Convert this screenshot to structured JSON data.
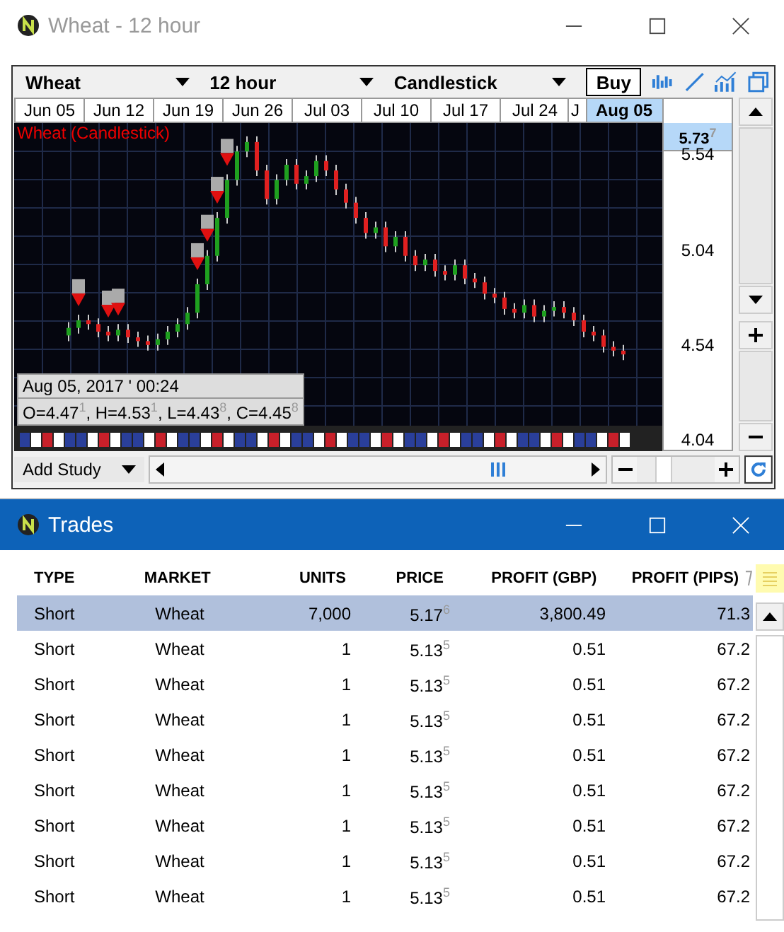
{
  "chart_window": {
    "title": "Wheat - 12 hour",
    "toolbar": {
      "market": "Wheat",
      "interval": "12 hour",
      "chart_type": "Candlestick",
      "buy": "Buy"
    },
    "chart_label": "Wheat (Candlestick)",
    "current_price": "5.73$^{7}$",
    "chart_data": {
      "type": "candlestick",
      "grid": true,
      "categories": [
        null,
        null,
        null,
        "Jun 05",
        null,
        null,
        null,
        null,
        null,
        null,
        "Jun 12",
        null,
        null,
        null,
        null,
        null,
        null,
        "Jun 19",
        null,
        null,
        null,
        null,
        null,
        null,
        "Jun 26",
        null,
        null,
        null,
        null,
        null,
        null,
        "Jul 03",
        null,
        null,
        null,
        null,
        null,
        null,
        "Jul 10",
        null,
        null,
        null,
        null,
        null,
        null,
        "Jul 17",
        null,
        null,
        null,
        null,
        null,
        null,
        "Jul 24",
        null,
        null,
        null,
        "J",
        null,
        null,
        null,
        null,
        "Aug 05"
      ],
      "ohlc": [
        null,
        null,
        null,
        null,
        null,
        [
          4.58,
          4.65,
          4.55,
          4.62
        ],
        [
          4.62,
          4.69,
          4.59,
          4.66
        ],
        [
          4.66,
          4.69,
          4.61,
          4.64
        ],
        [
          4.64,
          4.67,
          4.57,
          4.6
        ],
        [
          4.6,
          4.63,
          4.55,
          4.58
        ],
        [
          4.58,
          4.64,
          4.55,
          4.61
        ],
        [
          4.61,
          4.64,
          4.54,
          4.57
        ],
        [
          4.57,
          4.6,
          4.52,
          4.55
        ],
        [
          4.55,
          4.58,
          4.5,
          4.53
        ],
        [
          4.53,
          4.59,
          4.5,
          4.56
        ],
        [
          4.56,
          4.63,
          4.53,
          4.6
        ],
        [
          4.6,
          4.67,
          4.57,
          4.64
        ],
        [
          4.64,
          4.73,
          4.61,
          4.7
        ],
        [
          4.7,
          4.88,
          4.67,
          4.85
        ],
        [
          4.85,
          5.03,
          4.82,
          5.0
        ],
        [
          5.0,
          5.23,
          4.97,
          5.2
        ],
        [
          5.2,
          5.43,
          5.17,
          5.4
        ],
        [
          5.4,
          5.58,
          5.37,
          5.55
        ],
        [
          5.55,
          5.63,
          5.52,
          5.6
        ],
        [
          5.6,
          5.63,
          5.42,
          5.45
        ],
        [
          5.45,
          5.48,
          5.27,
          5.3
        ],
        [
          5.3,
          5.43,
          5.27,
          5.4
        ],
        [
          5.4,
          5.51,
          5.37,
          5.48
        ],
        [
          5.48,
          5.51,
          5.35,
          5.38
        ],
        [
          5.38,
          5.45,
          5.35,
          5.42
        ],
        [
          5.42,
          5.53,
          5.39,
          5.5
        ],
        [
          5.5,
          5.53,
          5.42,
          5.45
        ],
        [
          5.45,
          5.48,
          5.32,
          5.35
        ],
        [
          5.35,
          5.38,
          5.25,
          5.28
        ],
        [
          5.28,
          5.31,
          5.17,
          5.2
        ],
        [
          5.2,
          5.23,
          5.09,
          5.12
        ],
        [
          5.12,
          5.18,
          5.09,
          5.15
        ],
        [
          5.15,
          5.18,
          5.02,
          5.05
        ],
        [
          5.05,
          5.13,
          5.02,
          5.1
        ],
        [
          5.1,
          5.13,
          4.97,
          5.0
        ],
        [
          5.0,
          5.03,
          4.92,
          4.95
        ],
        [
          4.95,
          5.01,
          4.92,
          4.98
        ],
        [
          4.98,
          5.01,
          4.89,
          4.92
        ],
        [
          4.92,
          4.95,
          4.87,
          4.9
        ],
        [
          4.9,
          4.98,
          4.87,
          4.95
        ],
        [
          4.95,
          4.98,
          4.85,
          4.88
        ],
        [
          4.88,
          4.91,
          4.83,
          4.86
        ],
        [
          4.86,
          4.89,
          4.77,
          4.8
        ],
        [
          4.8,
          4.83,
          4.75,
          4.78
        ],
        [
          4.78,
          4.81,
          4.69,
          4.72
        ],
        [
          4.72,
          4.75,
          4.67,
          4.7
        ],
        [
          4.7,
          4.77,
          4.67,
          4.74
        ],
        [
          4.74,
          4.77,
          4.65,
          4.68
        ],
        [
          4.68,
          4.74,
          4.65,
          4.71
        ],
        [
          4.71,
          4.76,
          4.68,
          4.73
        ],
        [
          4.73,
          4.76,
          4.67,
          4.7
        ],
        [
          4.7,
          4.73,
          4.63,
          4.66
        ],
        [
          4.66,
          4.69,
          4.57,
          4.6
        ],
        [
          4.6,
          4.63,
          4.55,
          4.58
        ],
        [
          4.58,
          4.61,
          4.49,
          4.52
        ],
        [
          4.52,
          4.55,
          4.47,
          4.5
        ],
        [
          4.5,
          4.53,
          4.45,
          4.48
        ]
      ],
      "ylim": [
        3.97,
        5.7
      ],
      "yticks": [
        {
          "value": 5.54,
          "label": "5.54"
        },
        {
          "value": 5.04,
          "label": "5.04"
        },
        {
          "value": 4.54,
          "label": "4.54"
        },
        {
          "value": 4.04,
          "label": "4.04"
        }
      ]
    },
    "tooltip": {
      "date": "Aug 05, 2017 ' 00:24",
      "ohlc": "O=4.47$^{1}$, H=4.53$^{1}$, L=4.43$^{8}$, C=4.45$^{8}$"
    },
    "add_study": "Add Study",
    "zoom": {
      "level": 0.3
    }
  },
  "trades_window": {
    "title": "Trades",
    "columns": [
      "TYPE",
      "MARKET",
      "UNITS",
      "PRICE",
      "PROFIT (GBP)",
      "PROFIT (PIPS)"
    ],
    "rows": [
      {
        "selected": true,
        "cells": [
          "Short",
          "Wheat",
          "7,000",
          "5.17$^{6}$",
          "3,800.49",
          "71.3"
        ]
      },
      {
        "selected": false,
        "cells": [
          "Short",
          "Wheat",
          "1",
          "5.13$^{5}$",
          "0.51",
          "67.2"
        ]
      },
      {
        "selected": false,
        "cells": [
          "Short",
          "Wheat",
          "1",
          "5.13$^{5}$",
          "0.51",
          "67.2"
        ]
      },
      {
        "selected": false,
        "cells": [
          "Short",
          "Wheat",
          "1",
          "5.13$^{5}$",
          "0.51",
          "67.2"
        ]
      },
      {
        "selected": false,
        "cells": [
          "Short",
          "Wheat",
          "1",
          "5.13$^{5}$",
          "0.51",
          "67.2"
        ]
      },
      {
        "selected": false,
        "cells": [
          "Short",
          "Wheat",
          "1",
          "5.13$^{5}$",
          "0.51",
          "67.2"
        ]
      },
      {
        "selected": false,
        "cells": [
          "Short",
          "Wheat",
          "1",
          "5.13$^{5}$",
          "0.51",
          "67.2"
        ]
      },
      {
        "selected": false,
        "cells": [
          "Short",
          "Wheat",
          "1",
          "5.13$^{5}$",
          "0.51",
          "67.2"
        ]
      },
      {
        "selected": false,
        "cells": [
          "Short",
          "Wheat",
          "1",
          "5.13$^{5}$",
          "0.51",
          "67.2"
        ]
      }
    ]
  }
}
